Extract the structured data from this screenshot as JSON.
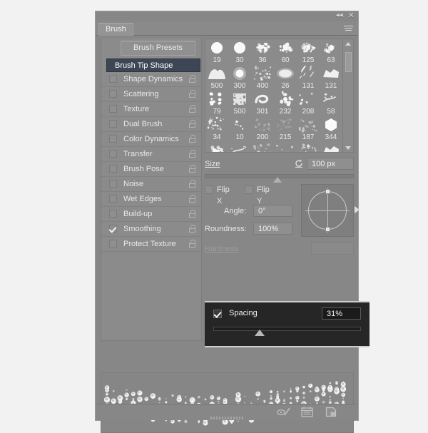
{
  "window": {
    "collapse_icon": "collapse-arrows-icon",
    "close_icon": "close-icon",
    "menu_icon": "panel-menu-icon"
  },
  "tab": {
    "label": "Brush"
  },
  "sidebar": {
    "presets_button": "Brush Presets",
    "items": [
      {
        "label": "Brush Tip Shape",
        "type": "header",
        "checked": false,
        "selected": true,
        "locked": false
      },
      {
        "label": "Shape Dynamics",
        "type": "option",
        "checked": false,
        "selected": false,
        "locked": true
      },
      {
        "label": "Scattering",
        "type": "option",
        "checked": false,
        "selected": false,
        "locked": true
      },
      {
        "label": "Texture",
        "type": "option",
        "checked": false,
        "selected": false,
        "locked": true
      },
      {
        "label": "Dual Brush",
        "type": "option",
        "checked": false,
        "selected": false,
        "locked": true
      },
      {
        "label": "Color Dynamics",
        "type": "option",
        "checked": false,
        "selected": false,
        "locked": true
      },
      {
        "label": "Transfer",
        "type": "option",
        "checked": false,
        "selected": false,
        "locked": true
      },
      {
        "label": "Brush Pose",
        "type": "option",
        "checked": false,
        "selected": false,
        "locked": true
      },
      {
        "label": "Noise",
        "type": "option",
        "checked": false,
        "selected": false,
        "locked": true
      },
      {
        "label": "Wet Edges",
        "type": "option",
        "checked": false,
        "selected": false,
        "locked": true
      },
      {
        "label": "Build-up",
        "type": "option",
        "checked": false,
        "selected": false,
        "locked": true
      },
      {
        "label": "Smoothing",
        "type": "option",
        "checked": true,
        "selected": false,
        "locked": true
      },
      {
        "label": "Protect Texture",
        "type": "option",
        "checked": false,
        "selected": false,
        "locked": true
      }
    ]
  },
  "brush_grid": {
    "columns": 6,
    "presets": [
      {
        "size": "19",
        "shape": "round-soft"
      },
      {
        "size": "30",
        "shape": "round-soft"
      },
      {
        "size": "36",
        "shape": "spatter"
      },
      {
        "size": "60",
        "shape": "spatter"
      },
      {
        "size": "125",
        "shape": "spatter"
      },
      {
        "size": "63",
        "shape": "spatter"
      },
      {
        "size": "500",
        "shape": "arch"
      },
      {
        "size": "300",
        "shape": "round-glow"
      },
      {
        "size": "400",
        "shape": "speckle"
      },
      {
        "size": "26",
        "shape": "blob"
      },
      {
        "size": "131",
        "shape": "streaks"
      },
      {
        "size": "131",
        "shape": "chunk"
      },
      {
        "size": "79",
        "shape": "dots-cluster"
      },
      {
        "size": "500",
        "shape": "square-rough"
      },
      {
        "size": "301",
        "shape": "swirl"
      },
      {
        "size": "232",
        "shape": "star-burst"
      },
      {
        "size": "208",
        "shape": "sparse-dots"
      },
      {
        "size": "58",
        "shape": "wisp"
      },
      {
        "size": "34",
        "shape": "fine-spatter"
      },
      {
        "size": "10",
        "shape": "tiny-dots"
      },
      {
        "size": "200",
        "shape": "faint-cloud"
      },
      {
        "size": "215",
        "shape": "faint-texture"
      },
      {
        "size": "187",
        "shape": "faint-spray"
      },
      {
        "size": "344",
        "shape": "hexagon"
      }
    ],
    "scroll_up_icon": "scroll-up-arrow-icon",
    "scroll_down_icon": "scroll-down-arrow-icon"
  },
  "controls": {
    "size": {
      "label": "Size",
      "value": "100 px",
      "slider_percent": 49,
      "reset_icon": "reset-size-icon"
    },
    "flip_x": {
      "label": "Flip X",
      "checked": false
    },
    "flip_y": {
      "label": "Flip Y",
      "checked": false
    },
    "angle": {
      "label": "Angle:",
      "value": "0°"
    },
    "roundness": {
      "label": "Roundness:",
      "value": "100%"
    },
    "hardness": {
      "label": "Hardness",
      "value": "",
      "disabled": true
    },
    "spacing": {
      "label": "Spacing",
      "value": "31%",
      "checked": true,
      "slider_percent": 31,
      "highlighted": true
    }
  },
  "footer": {
    "icons": [
      {
        "name": "toggle-brush-pencil-icon"
      },
      {
        "name": "open-preset-manager-icon"
      },
      {
        "name": "create-new-brush-icon"
      }
    ]
  }
}
